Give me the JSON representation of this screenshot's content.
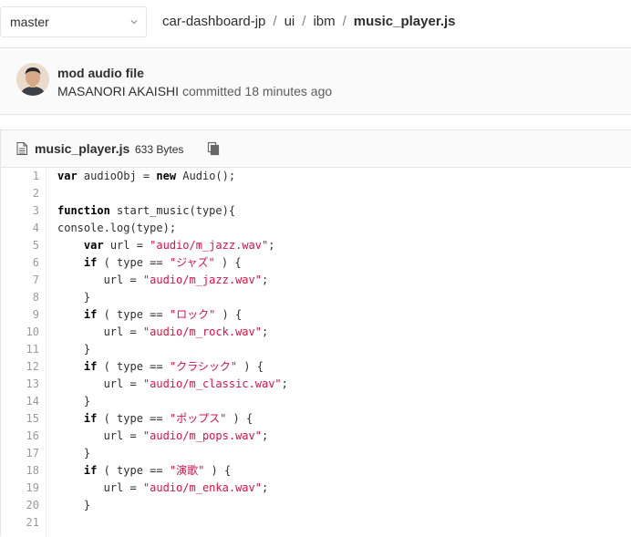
{
  "branch_selector": {
    "value": "master"
  },
  "breadcrumb": {
    "items": [
      "car-dashboard-jp",
      "ui",
      "ibm"
    ],
    "separator": "/",
    "file": "music_player.js"
  },
  "commit": {
    "title": "mod audio file",
    "author": "MASANORI AKAISHI",
    "action": "committed",
    "time": "18 minutes ago"
  },
  "file": {
    "name": "music_player.js",
    "size": "633 Bytes"
  },
  "code": {
    "lines": [
      {
        "n": "1",
        "segs": [
          [
            "kw",
            "var"
          ],
          [
            "t",
            " audioObj = "
          ],
          [
            "kw",
            "new"
          ],
          [
            "t",
            " Audio();"
          ]
        ]
      },
      {
        "n": "2",
        "segs": []
      },
      {
        "n": "3",
        "segs": [
          [
            "kw",
            "function"
          ],
          [
            "t",
            " start_music(type){"
          ]
        ]
      },
      {
        "n": "4",
        "segs": [
          [
            "t",
            "console.log(type);"
          ]
        ]
      },
      {
        "n": "5",
        "segs": [
          [
            "t",
            "    "
          ],
          [
            "kw",
            "var"
          ],
          [
            "t",
            " url = "
          ],
          [
            "str",
            "\"audio/m_jazz.wav\""
          ],
          [
            "t",
            ";"
          ]
        ]
      },
      {
        "n": "6",
        "segs": [
          [
            "t",
            "    "
          ],
          [
            "kw",
            "if"
          ],
          [
            "t",
            " ( type == "
          ],
          [
            "str",
            "\"ジャズ\""
          ],
          [
            "t",
            " ) {"
          ]
        ]
      },
      {
        "n": "7",
        "segs": [
          [
            "t",
            "       url = "
          ],
          [
            "str",
            "\"audio/m_jazz.wav\""
          ],
          [
            "t",
            ";"
          ]
        ]
      },
      {
        "n": "8",
        "segs": [
          [
            "t",
            "    }"
          ]
        ]
      },
      {
        "n": "9",
        "segs": [
          [
            "t",
            "    "
          ],
          [
            "kw",
            "if"
          ],
          [
            "t",
            " ( type == "
          ],
          [
            "str",
            "\"ロック\""
          ],
          [
            "t",
            " ) {"
          ]
        ]
      },
      {
        "n": "10",
        "segs": [
          [
            "t",
            "       url = "
          ],
          [
            "str",
            "\"audio/m_rock.wav\""
          ],
          [
            "t",
            ";"
          ]
        ]
      },
      {
        "n": "11",
        "segs": [
          [
            "t",
            "    }"
          ]
        ]
      },
      {
        "n": "12",
        "segs": [
          [
            "t",
            "    "
          ],
          [
            "kw",
            "if"
          ],
          [
            "t",
            " ( type == "
          ],
          [
            "str",
            "\"クラシック\""
          ],
          [
            "t",
            " ) {"
          ]
        ]
      },
      {
        "n": "13",
        "segs": [
          [
            "t",
            "       url = "
          ],
          [
            "str",
            "\"audio/m_classic.wav\""
          ],
          [
            "t",
            ";"
          ]
        ]
      },
      {
        "n": "14",
        "segs": [
          [
            "t",
            "    }"
          ]
        ]
      },
      {
        "n": "15",
        "segs": [
          [
            "t",
            "    "
          ],
          [
            "kw",
            "if"
          ],
          [
            "t",
            " ( type == "
          ],
          [
            "str",
            "\"ポップス\""
          ],
          [
            "t",
            " ) {"
          ]
        ]
      },
      {
        "n": "16",
        "segs": [
          [
            "t",
            "       url = "
          ],
          [
            "str",
            "\"audio/m_pops.wav\""
          ],
          [
            "t",
            ";"
          ]
        ]
      },
      {
        "n": "17",
        "segs": [
          [
            "t",
            "    }"
          ]
        ]
      },
      {
        "n": "18",
        "segs": [
          [
            "t",
            "    "
          ],
          [
            "kw",
            "if"
          ],
          [
            "t",
            " ( type == "
          ],
          [
            "str",
            "\"演歌\""
          ],
          [
            "t",
            " ) {"
          ]
        ]
      },
      {
        "n": "19",
        "segs": [
          [
            "t",
            "       url = "
          ],
          [
            "str",
            "\"audio/m_enka.wav\""
          ],
          [
            "t",
            ";"
          ]
        ]
      },
      {
        "n": "20",
        "segs": [
          [
            "t",
            "    }"
          ]
        ]
      },
      {
        "n": "21",
        "segs": []
      }
    ]
  },
  "icons": {
    "branch_dropdown": "chevron-down-icon",
    "file": "file-icon",
    "copy": "copy-icon",
    "avatar": "avatar"
  },
  "colors": {
    "keyword": "#000000",
    "string": "#dd1144",
    "line_number": "#9a9a9a",
    "header_bg": "#fafafa",
    "border": "#e5e5e5"
  }
}
